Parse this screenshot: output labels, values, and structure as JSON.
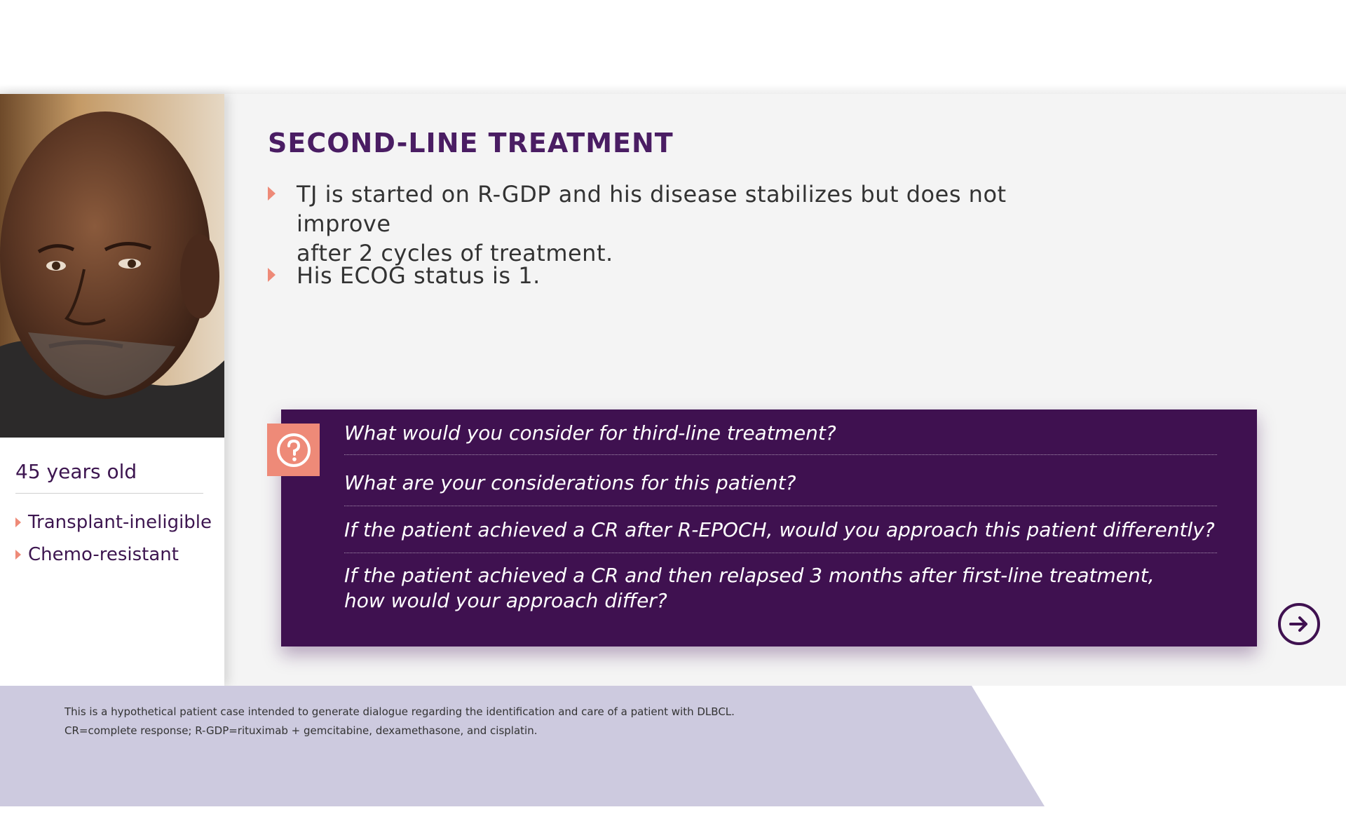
{
  "slide": {
    "title": "SECOND-LINE TREATMENT",
    "bullets": [
      "TJ is started on R-GDP and his disease stabilizes but does not improve",
      "after 2 cycles of treatment.",
      "His ECOG status is 1."
    ]
  },
  "patient": {
    "age": "45 years old",
    "tags": [
      "Transplant-ineligible",
      "Chemo-resistant"
    ]
  },
  "questions": [
    "What would you consider for third-line treatment?",
    "What are your considerations for this patient?",
    "If the patient achieved a CR after R-EPOCH, would you approach this patient differently?",
    "If the patient achieved a CR and then relapsed 3 months after first-line treatment, how would your approach differ?"
  ],
  "footnotes": [
    "This is a hypothetical patient case intended to generate dialogue regarding the identification and care of a patient with DLBCL.",
    "CR=complete response; R-GDP=rituximab + gemcitabine, dexamethasone, and cisplatin."
  ],
  "icons": {
    "question": "question-mark-circle-icon",
    "next": "arrow-right-circle-icon",
    "bullet": "triangle-bullet-icon"
  },
  "colors": {
    "brand_purple": "#3f1150",
    "title_purple": "#4a1d63",
    "accent_coral": "#ee8a78",
    "footer_lavender": "#cdcadf",
    "panel_grey": "#f4f4f4"
  }
}
